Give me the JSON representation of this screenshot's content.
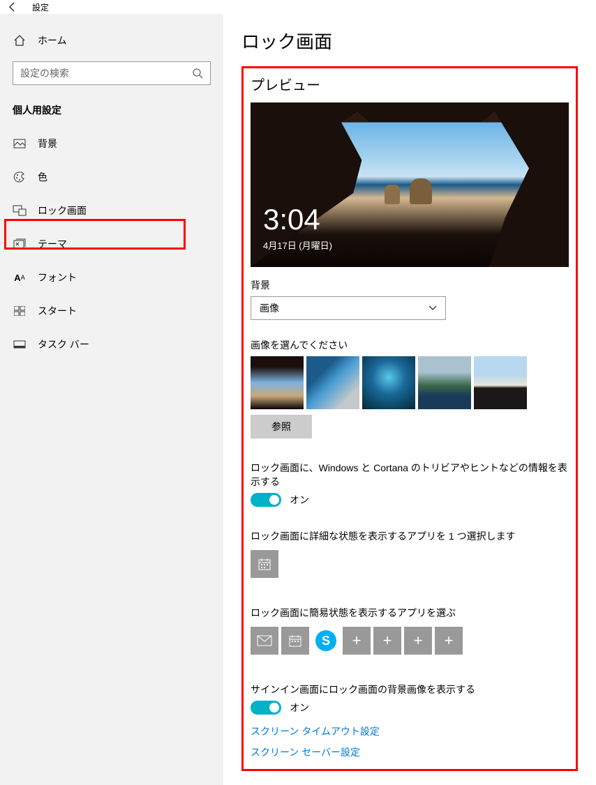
{
  "titlebar": {
    "title": "設定"
  },
  "sidebar": {
    "home": "ホーム",
    "search_placeholder": "設定の検索",
    "section": "個人用設定",
    "items": [
      {
        "label": "背景"
      },
      {
        "label": "色"
      },
      {
        "label": "ロック画面"
      },
      {
        "label": "テーマ"
      },
      {
        "label": "フォント"
      },
      {
        "label": "スタート"
      },
      {
        "label": "タスク バー"
      }
    ]
  },
  "main": {
    "title": "ロック画面",
    "preview_label": "プレビュー",
    "preview_time": "3:04",
    "preview_date": "4月17日 (月曜日)",
    "bg_label": "背景",
    "bg_selected": "画像",
    "choose_image_label": "画像を選んでください",
    "browse_btn": "参照",
    "trivia_label": "ロック画面に、Windows と Cortana のトリビアやヒントなどの情報を表示する",
    "trivia_state": "オン",
    "detailed_label": "ロック画面に詳細な状態を表示するアプリを 1 つ選択します",
    "quick_label": "ロック画面に簡易状態を表示するアプリを選ぶ",
    "signin_bg_label": "サインイン画面にロック画面の背景画像を表示する",
    "signin_bg_state": "オン",
    "link_timeout": "スクリーン タイムアウト設定",
    "link_screensaver": "スクリーン セーバー設定"
  }
}
